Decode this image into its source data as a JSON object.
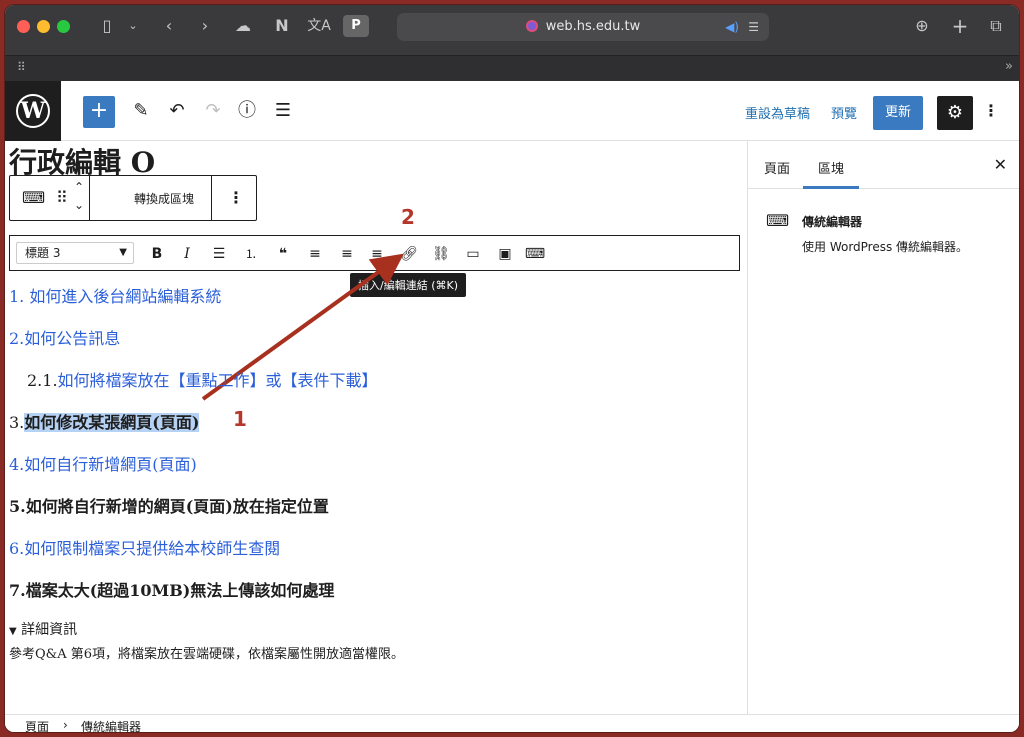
{
  "browser": {
    "url": "web.hs.edu.tw"
  },
  "wp_toolbar": {
    "revert_draft": "重設為草稿",
    "preview": "預覽",
    "update": "更新"
  },
  "editor": {
    "title_fragment": "行政編輯 O",
    "block_toolbar": {
      "transform_label": "轉換成區塊"
    },
    "classic_toolbar": {
      "format_value": "標題 3"
    },
    "tooltip": "插入/編輯連結 (⌘K)",
    "annotations": {
      "one": "1",
      "two": "2"
    },
    "lines": [
      {
        "num": "1.",
        "text": " 如何進入後台網站編輯系統",
        "style": "link"
      },
      {
        "num": "2.",
        "text": "如何公告訊息",
        "style": "link"
      },
      {
        "num": "2.1.",
        "text": "如何將檔案放在【重點工作】或【表件下載】",
        "style": "link"
      },
      {
        "num": "3.",
        "text": "如何修改某張網頁(頁面)",
        "style": "selected"
      },
      {
        "num": "4.",
        "text": "如何自行新增網頁(頁面)",
        "style": "link"
      },
      {
        "num": "5.",
        "text": "如何將自行新增的網頁(頁面)放在指定位置",
        "style": "plain"
      },
      {
        "num": "6.",
        "text": "如何限制檔案只提供給本校師生查閱",
        "style": "link"
      },
      {
        "num": "7.",
        "text": "檔案太大(超過10MB)無法上傳該如何處理",
        "style": "plain"
      }
    ],
    "details_summary": "詳細資訊",
    "details_text": "參考Q&A 第6項，將檔案放在雲端硬碟，依檔案屬性開放適當權限。"
  },
  "sidebar": {
    "tab_page": "頁面",
    "tab_block": "區塊",
    "block_name": "傳統編輯器",
    "block_desc": "使用 WordPress 傳統編輯器。"
  },
  "footer": {
    "crumb_page": "頁面",
    "crumb_block": "傳統編輯器"
  },
  "colors": {
    "accent": "#3a7ac0",
    "link": "#2b5fd9",
    "annotation": "#b5372c"
  }
}
